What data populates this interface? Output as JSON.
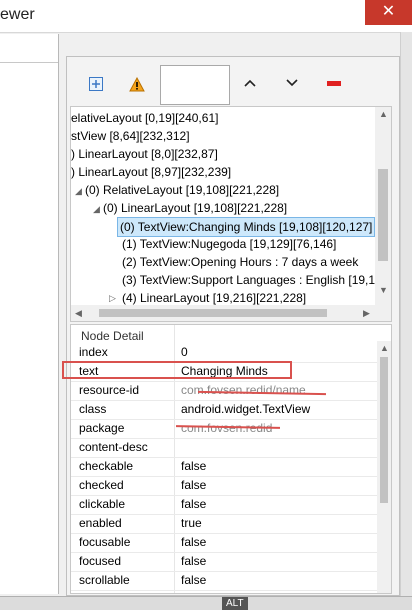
{
  "window": {
    "title": "ewer",
    "close_glyph": "✕"
  },
  "toolbar": {
    "icons": [
      "expand-all-icon",
      "warning-icon",
      "arrow-up-icon",
      "arrow-down-icon",
      "remove-icon"
    ],
    "zoom_value": ""
  },
  "tree": {
    "rows": [
      "elativeLayout [0,19][240,61]",
      "stView [8,64][232,312]",
      ") LinearLayout [8,0][232,87]",
      ") LinearLayout [8,97][232,239]",
      "(0) RelativeLayout [19,108][221,228]",
      "(0) LinearLayout [19,108][221,228]",
      "(0) TextView:Changing Minds [19,108][120,127]",
      "(1) TextView:Nugegoda [19,129][76,146]",
      "(2) TextView:Opening Hours        : 7 days a week",
      "(3) TextView:Support  Languages : English [19,18",
      "(4) LinearLayout [19,216][221,228]"
    ]
  },
  "detail": {
    "header": "Node Detail",
    "rows": [
      {
        "key": "index",
        "value": "0"
      },
      {
        "key": "text",
        "value": "Changing Minds"
      },
      {
        "key": "resource-id",
        "value": "com.fovsen.redid/name"
      },
      {
        "key": "class",
        "value": "android.widget.TextView"
      },
      {
        "key": "package",
        "value": "com.fovsen.redid"
      },
      {
        "key": "content-desc",
        "value": ""
      },
      {
        "key": "checkable",
        "value": "false"
      },
      {
        "key": "checked",
        "value": "false"
      },
      {
        "key": "clickable",
        "value": "false"
      },
      {
        "key": "enabled",
        "value": "true"
      },
      {
        "key": "focusable",
        "value": "false"
      },
      {
        "key": "focused",
        "value": "false"
      },
      {
        "key": "scrollable",
        "value": "false"
      }
    ]
  },
  "bottombar": {
    "label": "ALT"
  },
  "colors": {
    "highlight": "#d9514e",
    "selection": "#cde8fb",
    "close_button": "#c7382b"
  }
}
